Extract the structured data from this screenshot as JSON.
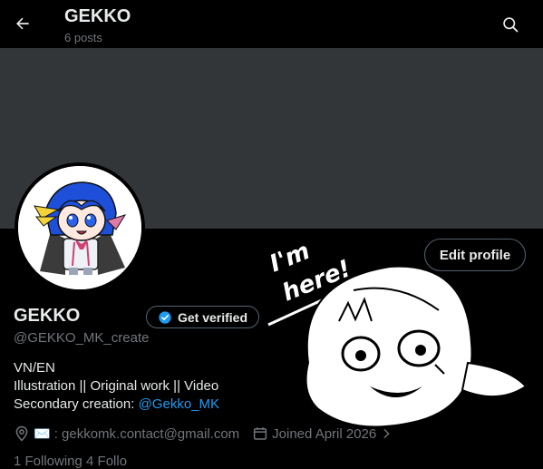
{
  "header": {
    "title": "GEKKO",
    "post_count": "6 posts"
  },
  "profile": {
    "name": "GEKKO",
    "handle": "@GEKKO_MK_create",
    "edit_button": "Edit profile",
    "verify_button": "Get verified",
    "doodle_text": [
      "I'm",
      "here!"
    ],
    "bio": {
      "line1": "VN/EN",
      "line2": "Illustration || Original work || Video",
      "line3_prefix": "Secondary creation: ",
      "line3_mention": "@Gekko_MK"
    },
    "meta": {
      "email_prefix": "✉️",
      "email_text": ": gekkomk.contact@gmail.com",
      "joined": "Joined April 2026",
      "cutoff_row": "1 Following   4 Follo"
    }
  },
  "colors": {
    "background": "#000000",
    "banner": "#333639",
    "link": "#1d9bf0",
    "secondary_text": "#71767b",
    "border": "#536471"
  },
  "icons": [
    "back-arrow-icon",
    "search-icon",
    "verified-badge-icon",
    "location-icon",
    "calendar-icon",
    "chevron-right-icon"
  ]
}
